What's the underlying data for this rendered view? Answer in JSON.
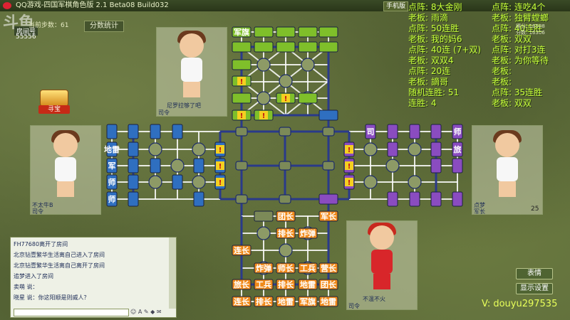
{
  "window": {
    "title": "QQ游戏-四国军棋角色版 2.1 Beta08 Build032",
    "menu_label": "手机版",
    "watermark_logo": "斗鱼"
  },
  "room": {
    "label": "房间号",
    "number": "55556",
    "step_count": "当前步数：61",
    "stats_button": "分数统计"
  },
  "treasure": {
    "label": "寻宝"
  },
  "players": {
    "top": {
      "name": "尼罗拉够了吧",
      "rank": "司令"
    },
    "left": {
      "name": "不太牛B",
      "rank": "司令"
    },
    "right": {
      "name": "点梦",
      "rank": "军长",
      "score": "25"
    },
    "bottom": {
      "name": "不温不火",
      "rank": "司令"
    }
  },
  "pieces": {
    "top": [
      "军旗"
    ],
    "left": [
      "地雷",
      "军",
      "师",
      "师"
    ],
    "right": [
      "司",
      "师",
      "旅"
    ],
    "bottom": [
      "团长",
      "军长",
      "排长",
      "炸弹",
      "连长",
      "炸弹",
      "师长",
      "工兵",
      "营长",
      "旅长",
      "工兵",
      "排长",
      "地雷",
      "团长",
      "连长",
      "排长",
      "地雷",
      "军旗",
      "地雷"
    ],
    "unknown_mark": "!"
  },
  "overlay": {
    "left_col": [
      "点阵: 8大金刚",
      "老板: 雨滴",
      "点阵: 50连胜",
      "老板: 我的妈6",
      "点阵: 40连 (7+双)",
      "老板: 双双4",
      "点阵: 20连",
      "老板: 謫哥",
      "随机连胜: 51",
      "连胜: 4"
    ],
    "right_col": [
      "点阵: 连吃4个",
      "老板: 独臂螳螂",
      "点阵: 40连胜",
      "老板: 双双",
      "点阵: 对打3连",
      "老板: 为你等待",
      "老板:",
      "老板:",
      "点阵: 35连胜",
      "老板: 双双"
    ],
    "status_lines": [
      "得分: 16588",
      "分数: 16306"
    ]
  },
  "chat": {
    "lines": [
      "FH77680离开了房间",
      "北京钻壹繁华生活离自己进入了房间",
      "北京钻壹繁华生活离自己离开了房间",
      "追梦进入了房间",
      "卖萌 说：",
      "晓星 说：你这阳顺是则威人？"
    ]
  },
  "buttons": {
    "emote": "表情",
    "show_settings": "显示设置"
  },
  "stream_id": "V: douyu297535",
  "colors": {
    "green_piece": "#7fbf2a",
    "blue_piece": "#2f6fc0",
    "purple_piece": "#8a4cc0",
    "orange_piece": "#f08a1a",
    "overlay_text": "#c7ff3a"
  }
}
